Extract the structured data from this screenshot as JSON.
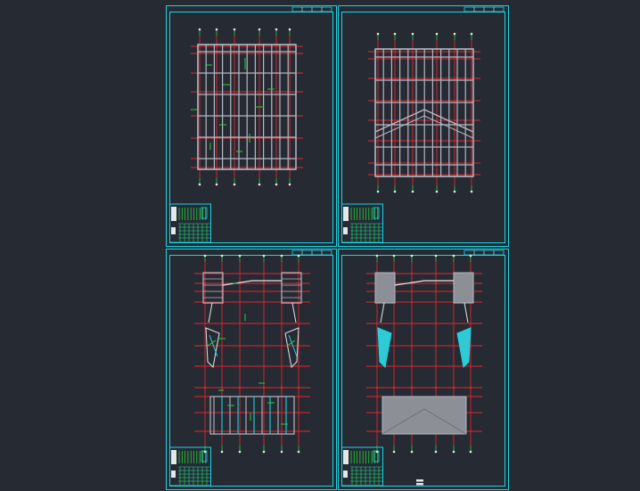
{
  "background": "#252a33",
  "colors": {
    "frame": "#19d6e6",
    "grid": "#e8262d",
    "structure": "#b4b8c2",
    "annotation": "#22d33a",
    "fill": "#8c8f96",
    "white": "#e6e6e6"
  },
  "sheets": [
    {
      "id": "sheet-top-left",
      "type": "floor-plan-grid"
    },
    {
      "id": "sheet-top-right",
      "type": "roof-plan-grid"
    },
    {
      "id": "sheet-bottom-left",
      "type": "section-plan-annotated"
    },
    {
      "id": "sheet-bottom-right",
      "type": "section-plan-filled"
    }
  ],
  "icons": {
    "title-block": "title-block-icon",
    "page-marker": "page-marker-icon"
  }
}
